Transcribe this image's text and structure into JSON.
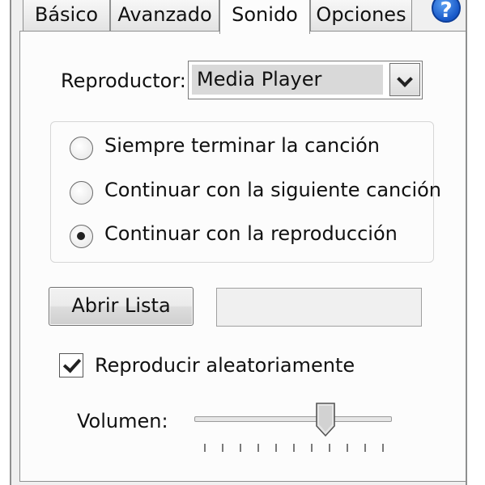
{
  "tabs": [
    {
      "label": "Básico",
      "active": false
    },
    {
      "label": "Avanzado",
      "active": false
    },
    {
      "label": "Sonido",
      "active": true
    },
    {
      "label": "Opciones",
      "active": false
    }
  ],
  "help_icon": {
    "icon": "help-icon",
    "glyph": "?"
  },
  "player": {
    "label": "Reproductor:",
    "selected": "Media Player"
  },
  "end_behavior": {
    "options": [
      {
        "label": "Siempre terminar la canción",
        "checked": false
      },
      {
        "label": "Continuar con la siguiente canción",
        "checked": false
      },
      {
        "label": "Continuar con la reproducción",
        "checked": true
      }
    ]
  },
  "open_list": {
    "label": "Abrir Lista",
    "path_value": ""
  },
  "shuffle": {
    "label": "Reproducir aleatoriamente",
    "checked": true
  },
  "volume": {
    "label": "Volumen:",
    "level": 0.68,
    "ticks": 11
  },
  "colors": {
    "accent": "#1858c8",
    "panel": "#fcfcfc",
    "background": "#f0f0f0"
  }
}
